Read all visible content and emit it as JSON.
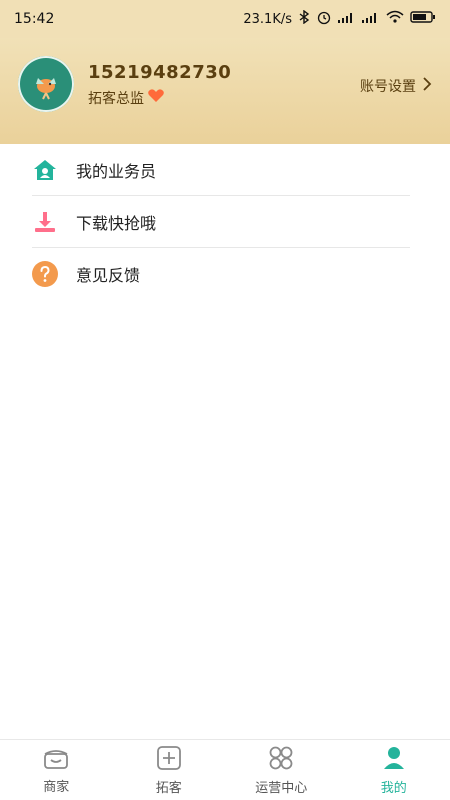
{
  "status": {
    "time": "15:42",
    "network_speed": "23.1K/s",
    "battery_icon": "battery-icon"
  },
  "header": {
    "phone": "15219482730",
    "role": "拓客总监",
    "settings_label": "账号设置"
  },
  "menu": {
    "items": [
      {
        "label": "我的业务员",
        "icon": "house-user-icon",
        "color": "#23b49c"
      },
      {
        "label": "下载快抢哦",
        "icon": "download-icon",
        "color": "#ff6f8b"
      },
      {
        "label": "意见反馈",
        "icon": "question-icon",
        "color": "#f39a4d"
      }
    ]
  },
  "tabs": [
    {
      "label": "商家",
      "icon": "store-icon"
    },
    {
      "label": "拓客",
      "icon": "plus-square-icon"
    },
    {
      "label": "运营中心",
      "icon": "grid-icon"
    },
    {
      "label": "我的",
      "icon": "person-icon",
      "active": true
    }
  ],
  "colors": {
    "header_bg_top": "#f1e1b7",
    "header_bg_bottom": "#ead19a",
    "accent": "#24b39b"
  }
}
